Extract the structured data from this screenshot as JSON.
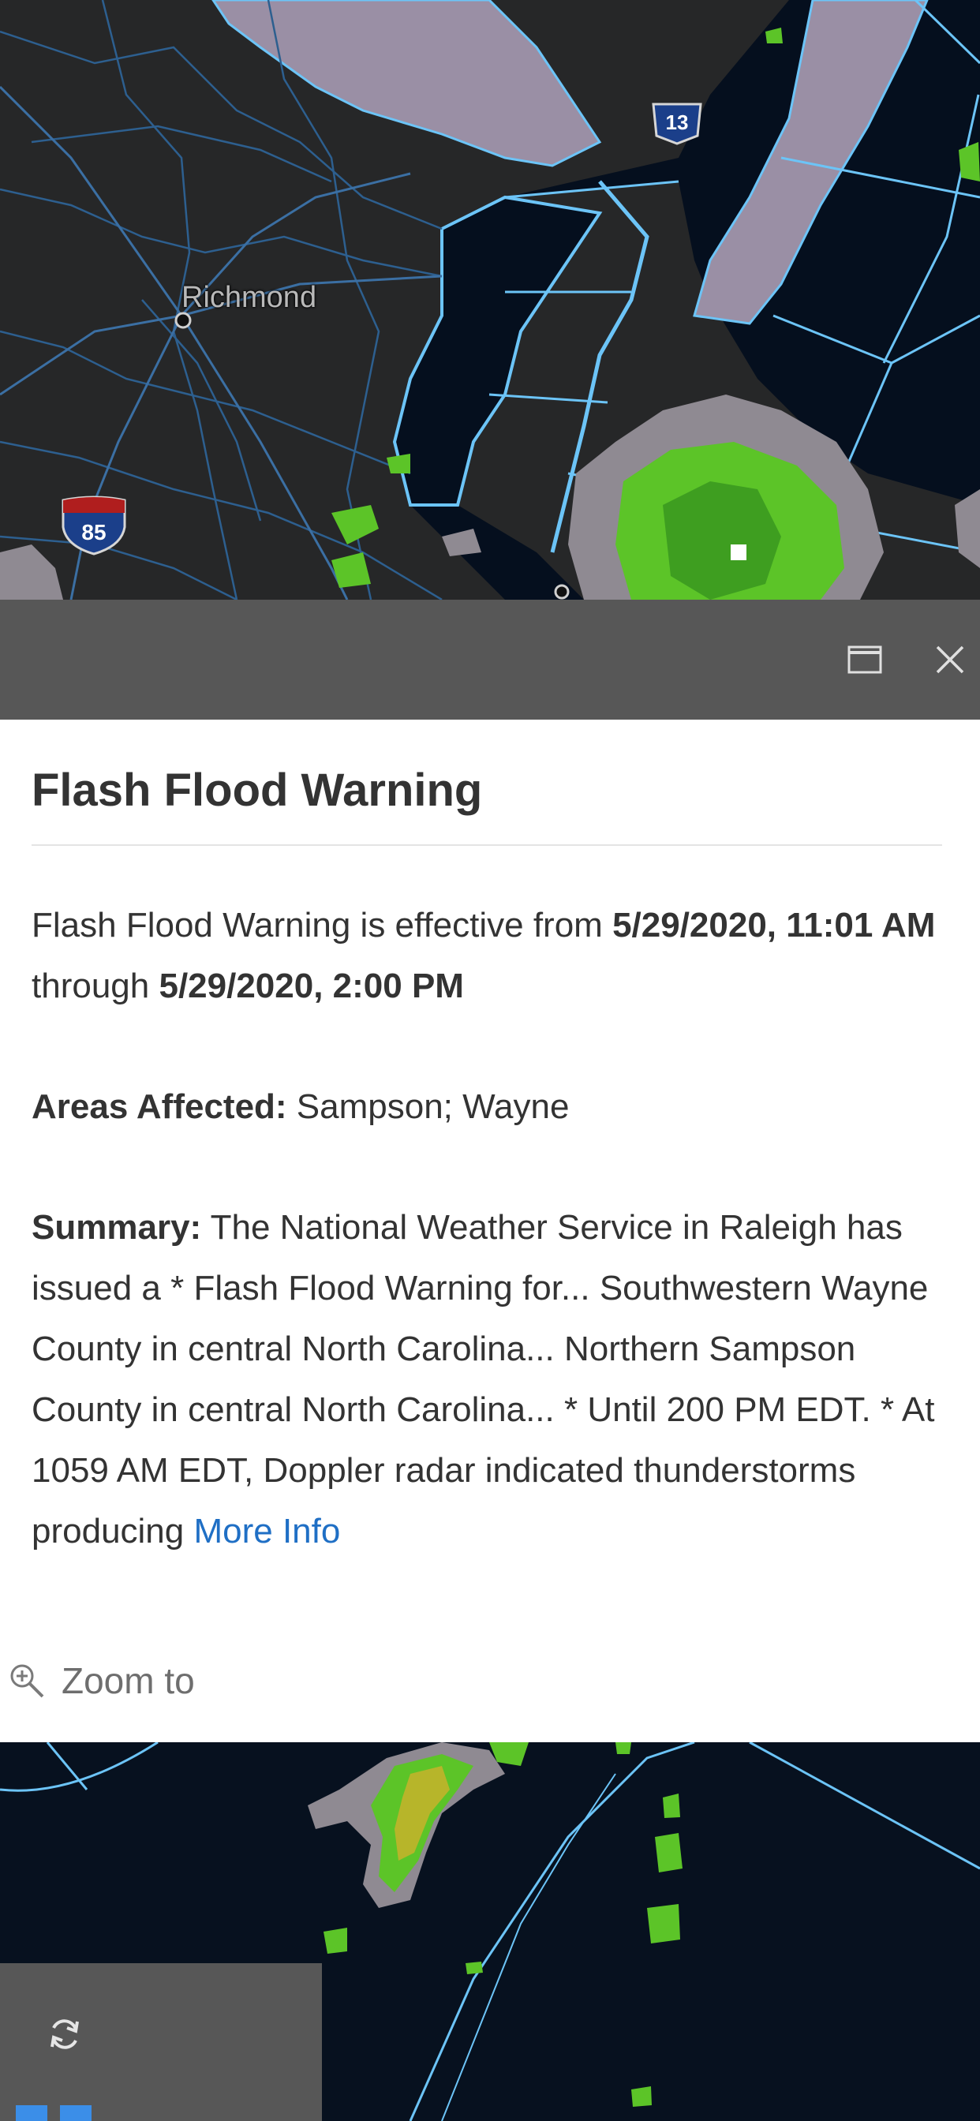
{
  "map": {
    "city_label": "Richmond",
    "shields": [
      {
        "route": "13",
        "type": "us-highway"
      },
      {
        "route": "85",
        "type": "interstate"
      }
    ],
    "colors": {
      "land": "#262728",
      "water": "#050f1e",
      "marine_zone": "#9a8fa5",
      "boundary": "#6cc4f7",
      "radar_green": "#5cc428",
      "radar_gray": "#8f8a92"
    }
  },
  "toolbar": {
    "maximize_icon": "maximize-icon",
    "close_icon": "close-icon"
  },
  "popup": {
    "title": "Flash Flood Warning",
    "effective_prefix": "Flash Flood Warning is effective from ",
    "effective_start": "5/29/2020, 11:01 AM",
    "effective_mid": " through ",
    "effective_end": "5/29/2020, 2:00 PM",
    "areas_label": "Areas Affected:",
    "areas_value": " Sampson; Wayne",
    "summary_label": "Summary:",
    "summary_text": " The National Weather Service in Raleigh has issued a * Flash Flood Warning for... Southwestern Wayne County in central North Carolina... Northern Sampson County in central North Carolina... * Until 200 PM EDT. * At 1059 AM EDT, Doppler radar indicated thunderstorms producing ",
    "more_info_label": "More Info",
    "zoom_to_label": "Zoom to",
    "link_color": "#1f6fc5"
  },
  "bottom_controls": {
    "refresh_icon": "refresh-icon"
  }
}
